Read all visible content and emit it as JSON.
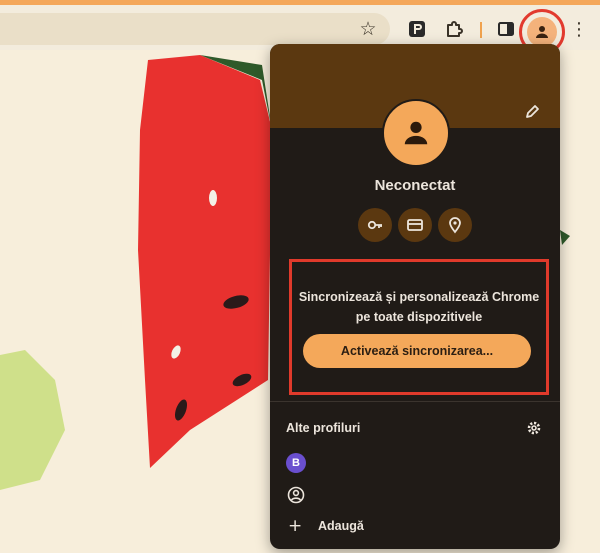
{
  "toolbar": {
    "icons": [
      "star-icon",
      "extension-p-icon",
      "puzzle-icon",
      "side-panel-icon",
      "profile-icon",
      "more-vert-icon"
    ],
    "accent_color": "#f4a75a",
    "highlight_color": "#e23a2e"
  },
  "profile_popup": {
    "profile_name": "Neconectat",
    "quick_icons": [
      "key-icon",
      "credit-card-icon",
      "location-pin-icon"
    ],
    "sync_message": "Sincronizează și personalizează Chrome pe toate dispozitivele",
    "sync_button": "Activează sincronizarea...",
    "other_profiles_title": "Alte profiluri",
    "profiles": [
      {
        "initial": "B",
        "avatar_color": "#6a4fcf"
      },
      {
        "icon": "guest-profile-icon"
      }
    ],
    "add_label": "Adaugă",
    "colors": {
      "banner": "#5b3810",
      "panel": "#201b17",
      "button": "#f4a85a"
    }
  }
}
